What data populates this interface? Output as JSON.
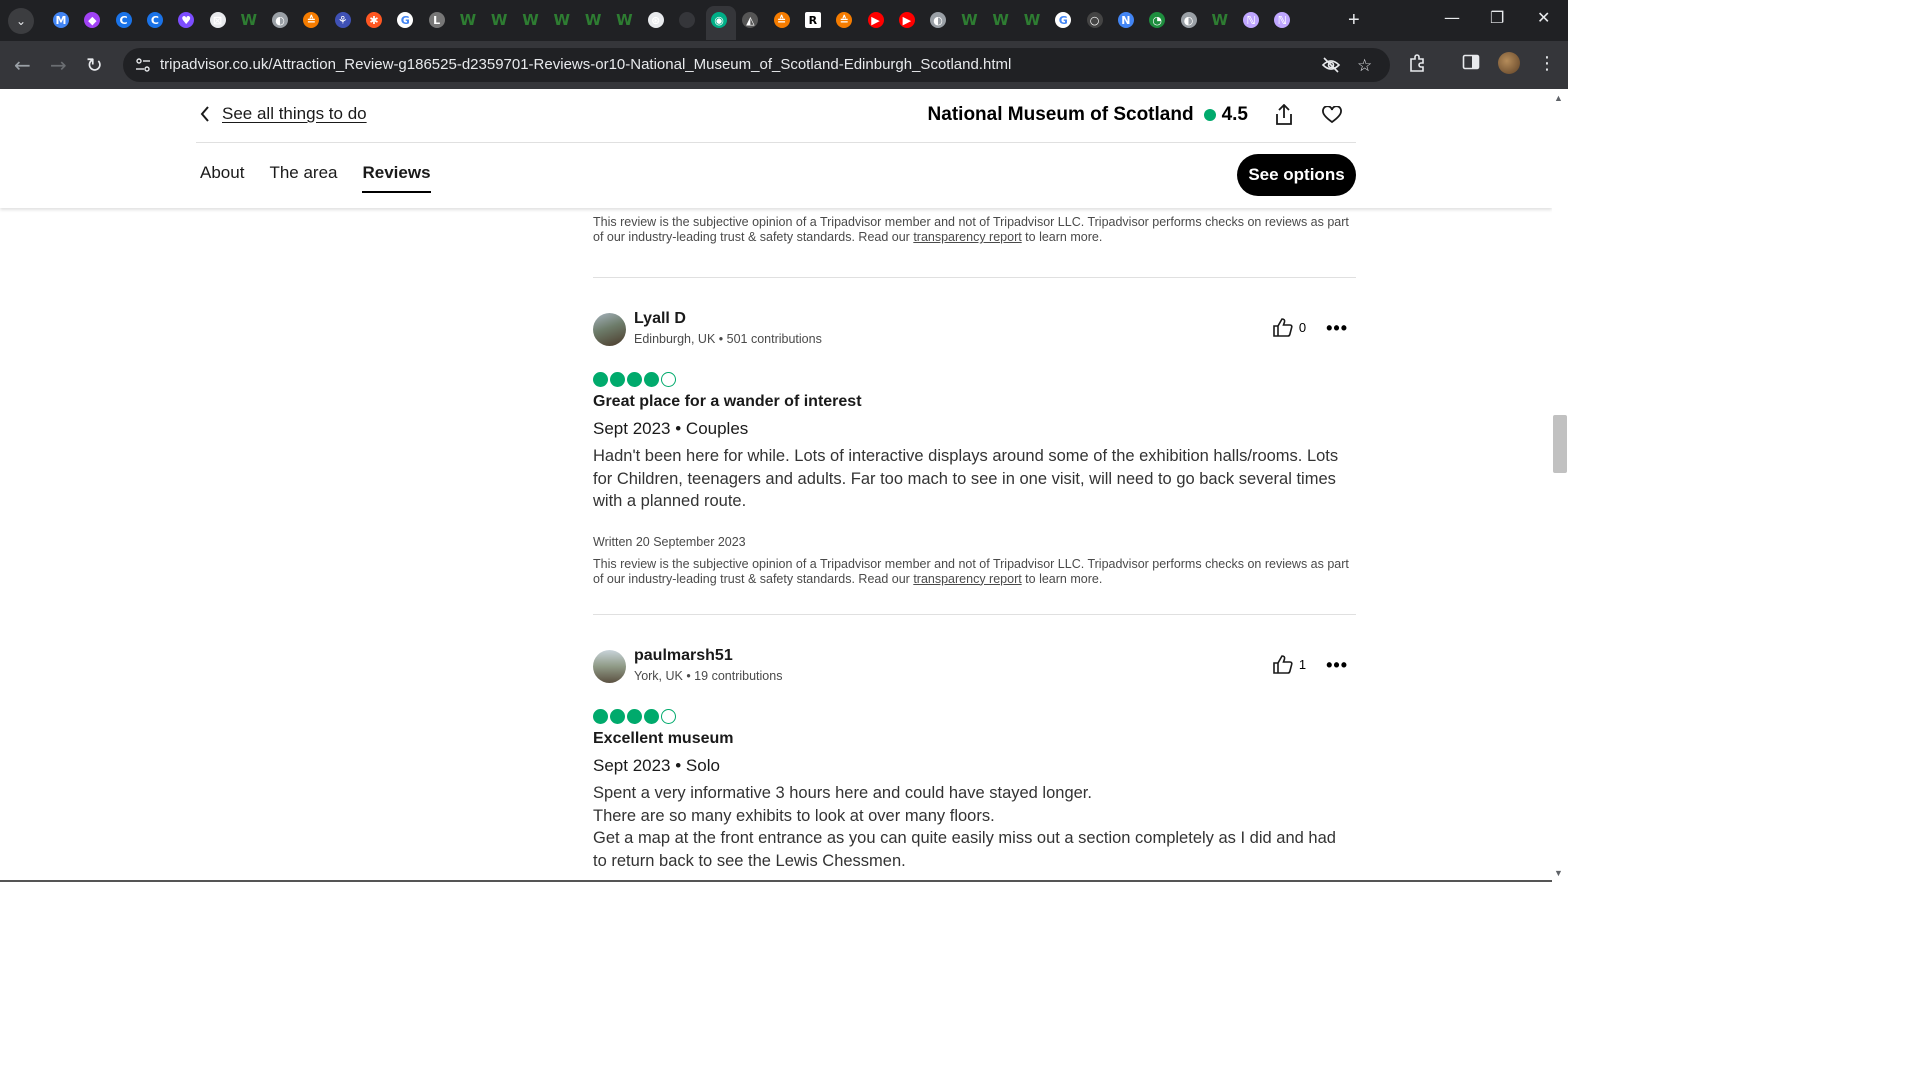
{
  "browser": {
    "url": "tripadvisor.co.uk/Attraction_Review-g186525-d2359701-Reviews-or10-National_Museum_of_Scotland-Edinburgh_Scotland.html",
    "active_tab_close": "✕",
    "tab_favicons": [
      "M",
      "◆",
      "C",
      "C",
      "♥",
      "⊠",
      "W",
      "◐",
      "≙",
      "⚘",
      "✱",
      "G",
      "L",
      "W",
      "W",
      "W",
      "W",
      "W",
      "W",
      "⊛",
      "",
      "◉",
      "◭",
      "≙",
      "R",
      "≙",
      "▶",
      "▶",
      "◐",
      "W",
      "W",
      "W",
      "G",
      "○",
      "N",
      "◔",
      "◐",
      "W",
      "ℕ",
      "ℕ"
    ]
  },
  "header": {
    "back_label": "See all things to do",
    "title": "National Museum of Scotland",
    "rating": "4.5",
    "tabs": [
      {
        "label": "About"
      },
      {
        "label": "The area"
      },
      {
        "label": "Reviews"
      }
    ],
    "cta": "See options"
  },
  "disclaimer": {
    "text_before": "This review is the subjective opinion of a Tripadvisor member and not of Tripadvisor LLC. Tripadvisor performs checks on reviews as part of our industry-leading trust & safety standards. Read our ",
    "link": "transparency report",
    "text_after": " to learn more."
  },
  "reviews": [
    {
      "author": "Lyall D",
      "meta": "Edinburgh, UK • 501 contributions",
      "helpful_count": "0",
      "rating": 4,
      "title": "Great place for a wander of interest",
      "date_line": "Sept 2023 • Couples",
      "body": "Hadn't been here for while. Lots of interactive displays around some of the exhibition halls/rooms. Lots for Children, teenagers and adults. Far too mach to see in one visit, will need to go back several times with a planned route.",
      "written": "Written 20 September 2023"
    },
    {
      "author": "paulmarsh51",
      "meta": "York, UK • 19 contributions",
      "helpful_count": "1",
      "rating": 4,
      "title": "Excellent museum",
      "date_line": "Sept 2023 • Solo",
      "body_lines": [
        "Spent a very informative 3 hours here and could have stayed longer.",
        "There are so many exhibits to look at over many floors.",
        "Get a map at the front entrance as you can quite easily miss out a section completely as I did and had to return back to see the Lewis Chessmen."
      ]
    }
  ],
  "colors": {
    "brand_green": "#00aa6c",
    "chrome_dark": "#202124",
    "chrome_toolbar": "#35363a"
  }
}
